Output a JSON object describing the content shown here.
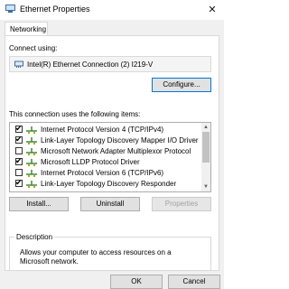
{
  "window": {
    "title": "Ethernet Properties",
    "close_glyph": "✕"
  },
  "tabs": [
    {
      "label": "Networking"
    }
  ],
  "connect_using": {
    "label": "Connect using:",
    "adapter": "Intel(R) Ethernet Connection (2) I219-V"
  },
  "buttons": {
    "configure": "Configure...",
    "install": "Install...",
    "uninstall": "Uninstall",
    "properties": "Properties",
    "ok": "OK",
    "cancel": "Cancel"
  },
  "items_label": "This connection uses the following items:",
  "items": [
    {
      "label": "Internet Protocol Version 4 (TCP/IPv4)",
      "checked": true,
      "icon": "protocol-icon"
    },
    {
      "label": "Link-Layer Topology Discovery Mapper I/O Driver",
      "checked": true,
      "icon": "protocol-icon"
    },
    {
      "label": "Microsoft Network Adapter Multiplexor Protocol",
      "checked": false,
      "icon": "protocol-icon"
    },
    {
      "label": "Microsoft LLDP Protocol Driver",
      "checked": true,
      "icon": "protocol-icon"
    },
    {
      "label": "Internet Protocol Version 6 (TCP/IPv6)",
      "checked": false,
      "icon": "protocol-icon"
    },
    {
      "label": "Link-Layer Topology Discovery Responder",
      "checked": true,
      "icon": "protocol-icon"
    }
  ],
  "description": {
    "title": "Description",
    "text": "Allows your computer to access resources on a Microsoft network."
  },
  "colors": {
    "focus_border": "#0078d7",
    "protocol_icon": "#3a8a3a"
  }
}
